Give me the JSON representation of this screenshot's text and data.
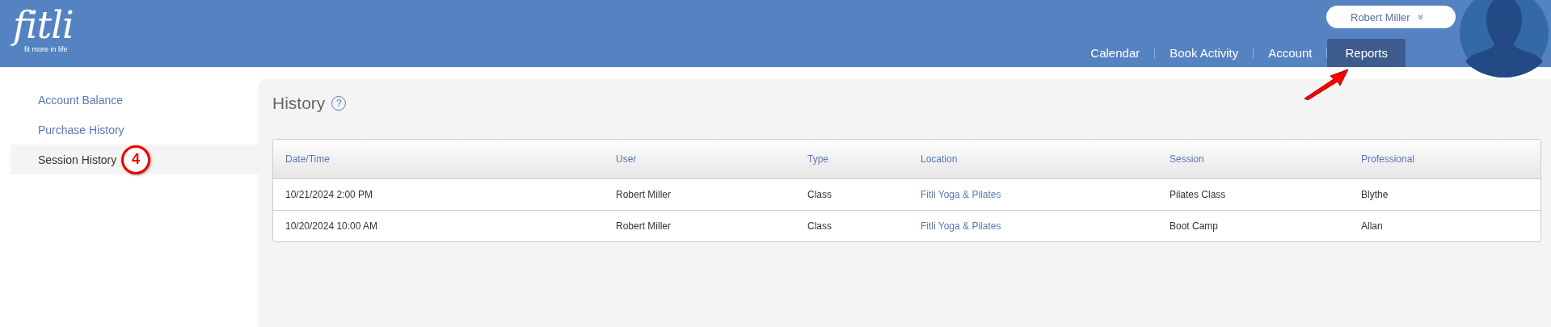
{
  "header": {
    "logo": "fitli",
    "tagline": "fit more in life",
    "user_menu": {
      "label": "Robert Miller",
      "icon": "»"
    },
    "nav": [
      {
        "label": "Calendar",
        "selected": false
      },
      {
        "label": "Book Activity",
        "selected": false
      },
      {
        "label": "Account",
        "selected": false
      },
      {
        "label": "Reports",
        "selected": true
      }
    ]
  },
  "sidebar": {
    "items": [
      {
        "label": "Account Balance",
        "selected": false
      },
      {
        "label": "Purchase History",
        "selected": false
      },
      {
        "label": "Session History",
        "selected": true
      }
    ]
  },
  "step_badge": "4",
  "page": {
    "title": "History",
    "help": "?"
  },
  "table": {
    "columns": [
      {
        "label": "Date/Time",
        "kind": "text"
      },
      {
        "label": "User",
        "kind": "text"
      },
      {
        "label": "Type",
        "kind": "text"
      },
      {
        "label": "Location",
        "kind": "link"
      },
      {
        "label": "Session",
        "kind": "text"
      },
      {
        "label": "Professional",
        "kind": "text"
      }
    ],
    "rows": [
      [
        "10/21/2024 2:00 PM",
        "Robert Miller",
        "Class",
        "Fitli Yoga & Pilates",
        "Pilates Class",
        "Blythe"
      ],
      [
        "10/20/2024 10:00 AM",
        "Robert Miller",
        "Class",
        "Fitli Yoga & Pilates",
        "Boot Camp",
        "Allan"
      ]
    ]
  }
}
